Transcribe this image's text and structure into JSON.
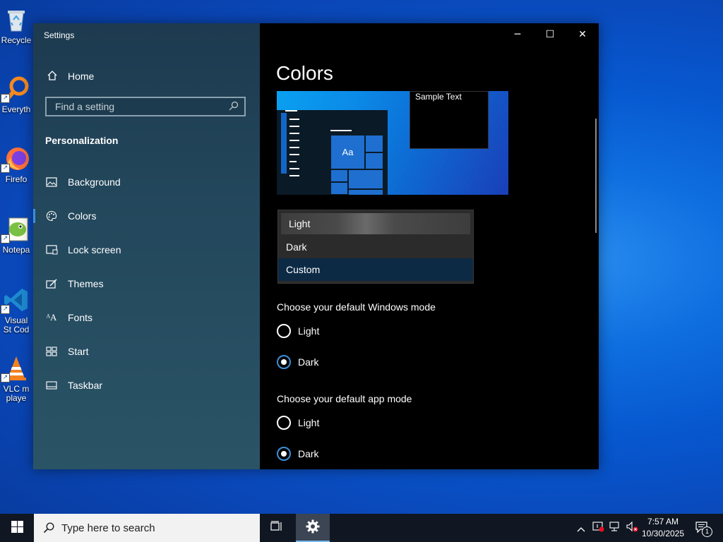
{
  "desktop": {
    "icons": [
      {
        "label": "Recycle",
        "icon": "recycle-bin-icon"
      },
      {
        "label": "Everyth",
        "icon": "everything-search-icon"
      },
      {
        "label": "Firefo",
        "icon": "firefox-icon"
      },
      {
        "label": "Notepa",
        "icon": "notepad-plus-plus-icon"
      },
      {
        "label": "Visual St Cod",
        "icon": "vscode-icon"
      },
      {
        "label": "VLC m playe",
        "icon": "vlc-icon"
      }
    ]
  },
  "window": {
    "title": "Settings",
    "controls": {
      "minimize": "─",
      "maximize": "☐",
      "close": "✕"
    }
  },
  "sidebar": {
    "home": "Home",
    "search_placeholder": "Find a setting",
    "section": "Personalization",
    "items": [
      {
        "label": "Background",
        "icon": "picture-icon"
      },
      {
        "label": "Colors",
        "icon": "palette-icon",
        "active": true
      },
      {
        "label": "Lock screen",
        "icon": "lock-screen-icon"
      },
      {
        "label": "Themes",
        "icon": "brush-icon"
      },
      {
        "label": "Fonts",
        "icon": "fonts-icon"
      },
      {
        "label": "Start",
        "icon": "start-icon"
      },
      {
        "label": "Taskbar",
        "icon": "taskbar-icon"
      }
    ]
  },
  "main": {
    "title": "Colors",
    "preview": {
      "sample_text": "Sample Text",
      "tile_text": "Aa"
    },
    "color_dropdown": {
      "options": [
        "Light",
        "Dark",
        "Custom"
      ],
      "hovered": "Light",
      "selected": "Custom"
    },
    "windows_mode": {
      "label": "Choose your default Windows mode",
      "options": [
        "Light",
        "Dark"
      ],
      "selected": "Dark"
    },
    "app_mode": {
      "label": "Choose your default app mode",
      "options": [
        "Light",
        "Dark"
      ],
      "selected": "Dark"
    }
  },
  "taskbar": {
    "search_placeholder": "Type here to search",
    "time": "7:57 AM",
    "date": "10/30/2025",
    "notification_count": "1"
  },
  "colors": {
    "accent": "#3b8fd8",
    "sidebar_bg": "#23475c",
    "main_bg": "#000000",
    "taskbar_bg": "#101722"
  }
}
